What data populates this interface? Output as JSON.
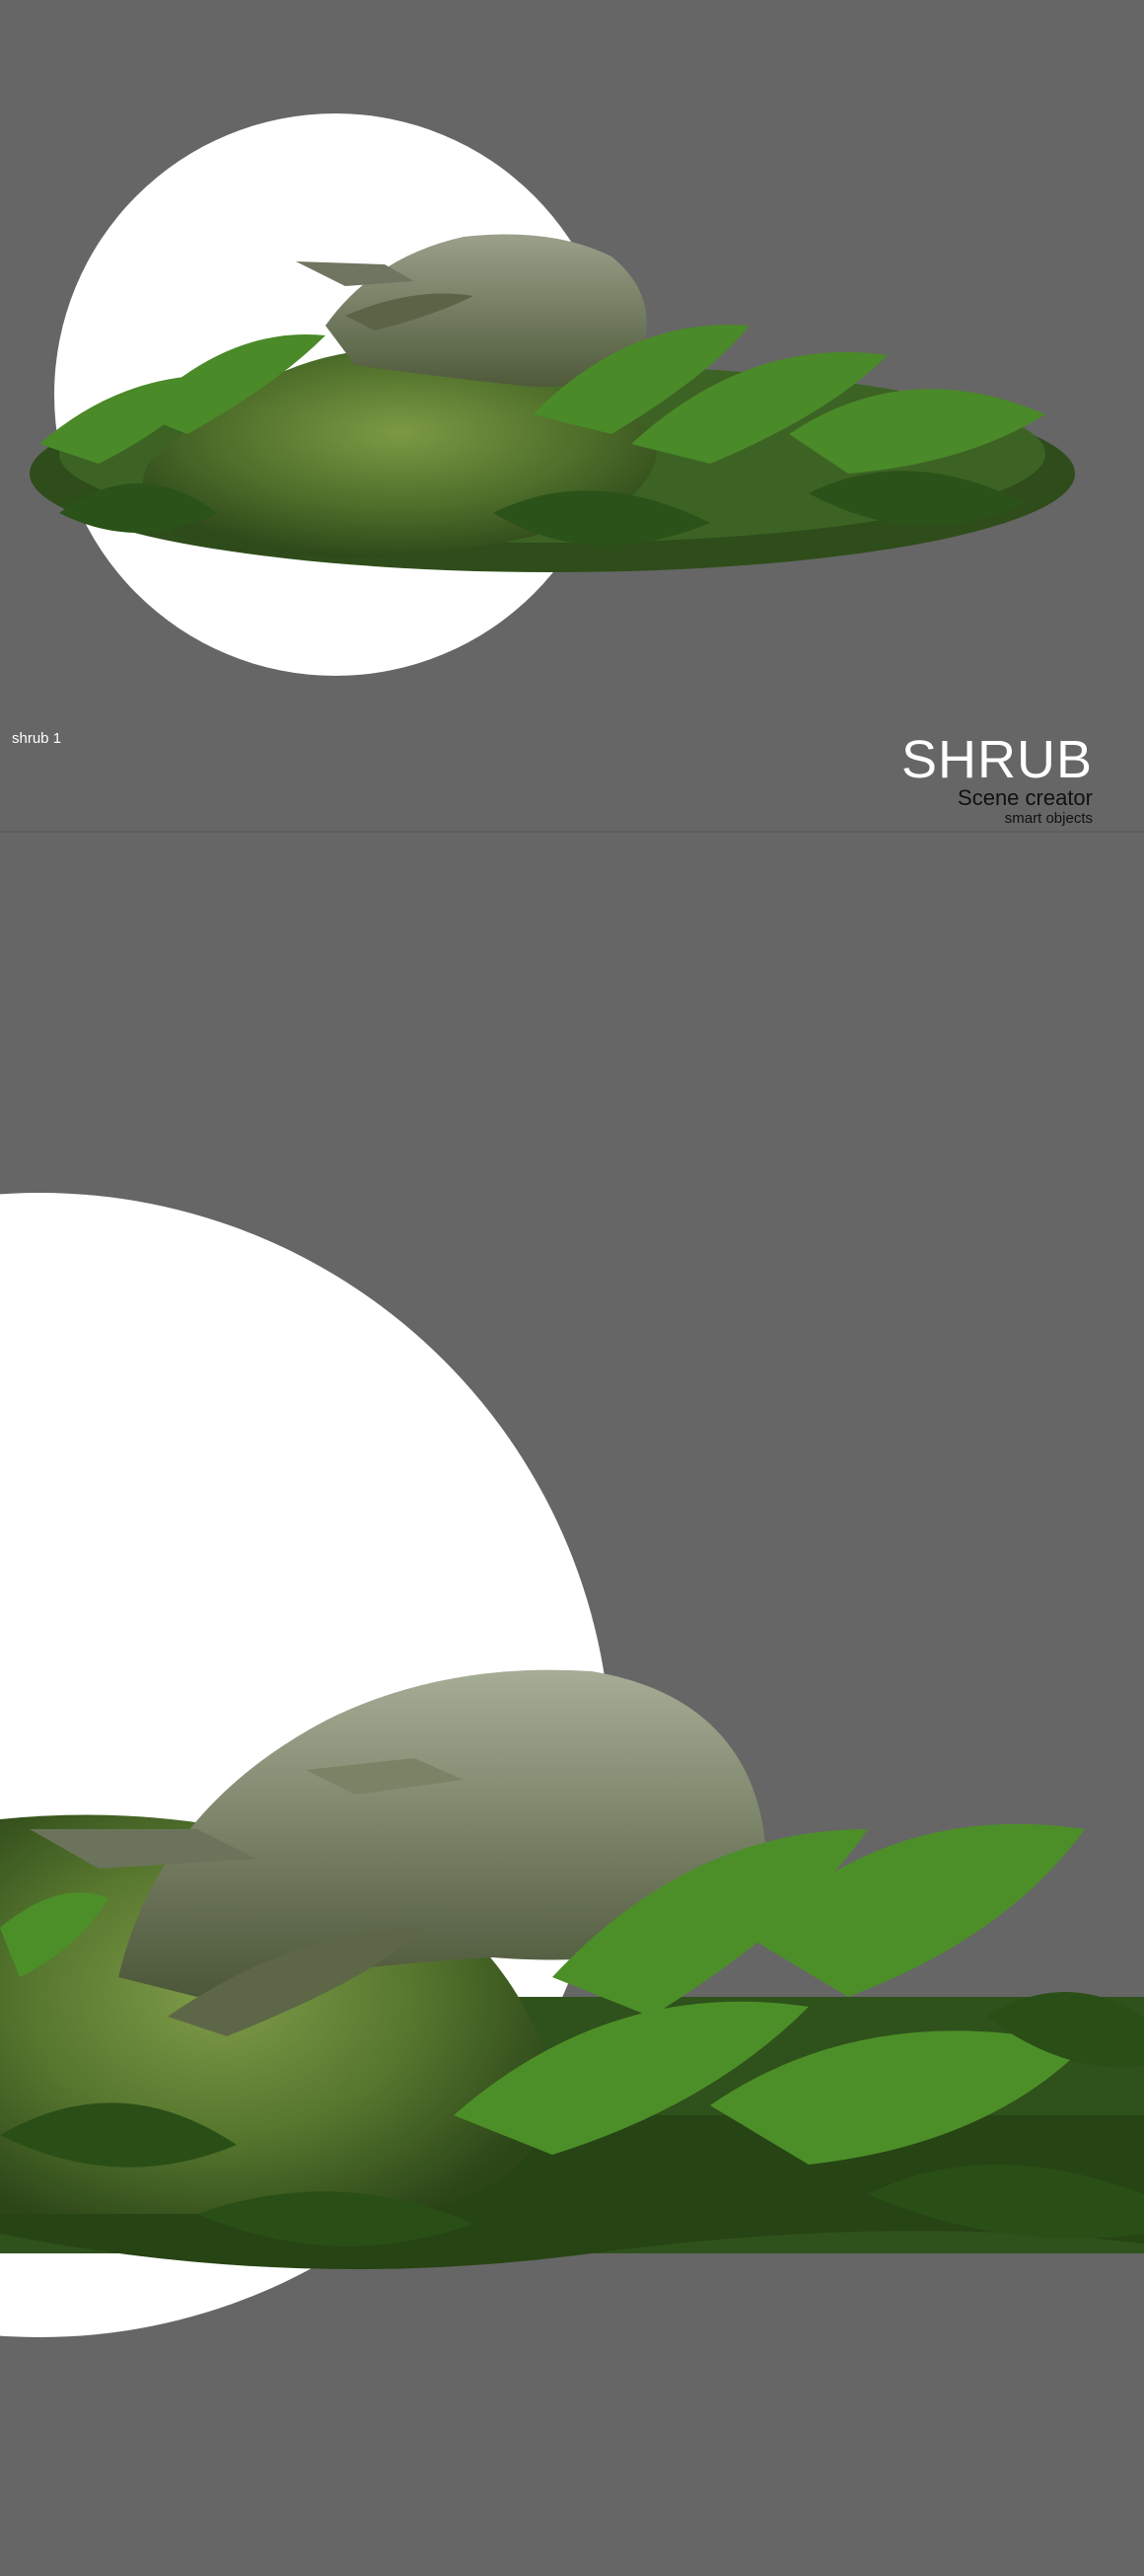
{
  "top_panel": {
    "caption": "shrub 1",
    "brand": {
      "title": "SHRUB",
      "subtitle": "Scene creator",
      "tagline": "smart objects"
    }
  },
  "colors": {
    "background": "#666666",
    "circle": "#ffffff",
    "moss": "#5b7a2e",
    "fern": "#3f7d22",
    "rock": "#7d8470"
  },
  "images": [
    {
      "name": "shrub-moss-rock-overview",
      "description": "mossy rock with ferns and grass on white circle"
    },
    {
      "name": "shrub-moss-rock-closeup",
      "description": "close-up of mossy rock with ferns and grass"
    }
  ]
}
